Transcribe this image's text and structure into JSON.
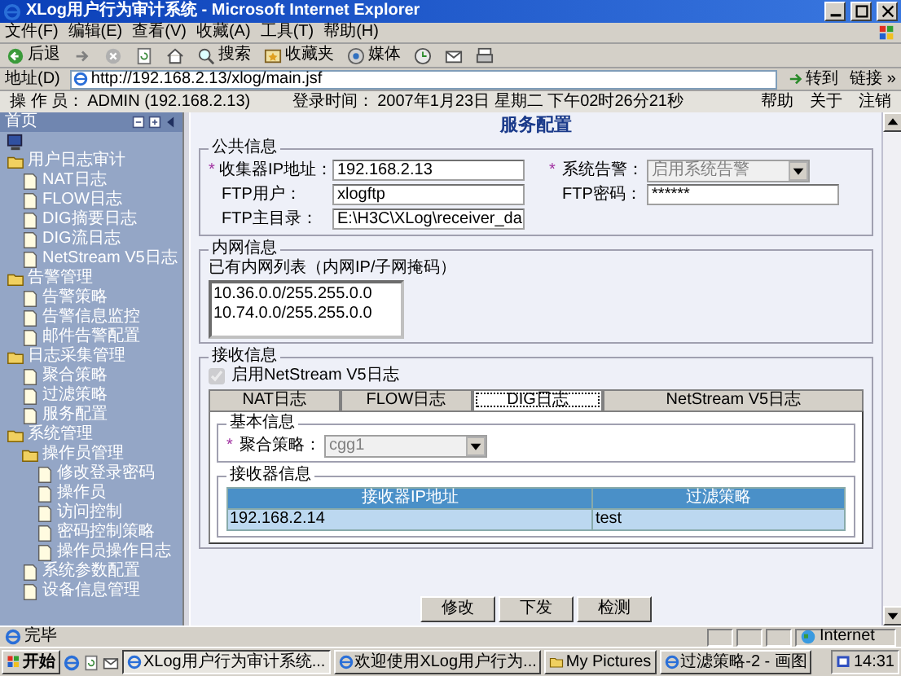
{
  "window": {
    "title": "XLog用户行为审计系统 - Microsoft Internet Explorer"
  },
  "menu": [
    "文件(F)",
    "编辑(E)",
    "查看(V)",
    "收藏(A)",
    "工具(T)",
    "帮助(H)"
  ],
  "toolbar": [
    {
      "kind": "back",
      "label": "后退"
    },
    {
      "kind": "forward"
    },
    {
      "kind": "stop"
    },
    {
      "kind": "refresh"
    },
    {
      "kind": "home"
    },
    {
      "kind": "search",
      "label": "搜索"
    },
    {
      "kind": "favorites",
      "label": "收藏夹"
    },
    {
      "kind": "media",
      "label": "媒体"
    },
    {
      "kind": "history"
    },
    {
      "kind": "mail"
    },
    {
      "kind": "print"
    }
  ],
  "address": {
    "label": "地址(D)",
    "url": "http://192.168.2.13/xlog/main.jsf",
    "go": "转到",
    "links": "链接 »"
  },
  "app_header": {
    "operator_label": "操 作 员：",
    "operator": "ADMIN (192.168.2.13)",
    "login_label": "登录时间：",
    "login_time": "2007年1月23日 星期二 下午02时26分21秒",
    "links": [
      "帮助",
      "关于",
      "注销"
    ]
  },
  "sidebar": {
    "title": "首页",
    "tree": [
      {
        "label": "用户日志审计",
        "kind": "folder",
        "children": [
          {
            "label": "NAT日志",
            "kind": "page"
          },
          {
            "label": "FLOW日志",
            "kind": "page"
          },
          {
            "label": "DIG摘要日志",
            "kind": "page"
          },
          {
            "label": "DIG流日志",
            "kind": "page"
          },
          {
            "label": "NetStream V5日志",
            "kind": "page"
          }
        ]
      },
      {
        "label": "告警管理",
        "kind": "folder",
        "children": [
          {
            "label": "告警策略",
            "kind": "page"
          },
          {
            "label": "告警信息监控",
            "kind": "page"
          },
          {
            "label": "邮件告警配置",
            "kind": "page"
          }
        ]
      },
      {
        "label": "日志采集管理",
        "kind": "folder",
        "children": [
          {
            "label": "聚合策略",
            "kind": "page"
          },
          {
            "label": "过滤策略",
            "kind": "page"
          },
          {
            "label": "服务配置",
            "kind": "page"
          }
        ]
      },
      {
        "label": "系统管理",
        "kind": "folder",
        "children": [
          {
            "label": "操作员管理",
            "kind": "folder",
            "children": [
              {
                "label": "修改登录密码",
                "kind": "page"
              },
              {
                "label": "操作员",
                "kind": "page"
              },
              {
                "label": "访问控制",
                "kind": "page"
              },
              {
                "label": "密码控制策略",
                "kind": "page"
              },
              {
                "label": "操作员操作日志",
                "kind": "page"
              }
            ]
          },
          {
            "label": "系统参数配置",
            "kind": "page"
          },
          {
            "label": "设备信息管理",
            "kind": "page"
          }
        ]
      }
    ]
  },
  "page": {
    "title": "服务配置",
    "common": {
      "legend": "公共信息",
      "rows": [
        [
          {
            "marker": "*",
            "label": "收集器IP地址：",
            "kind": "text",
            "value": "192.168.2.13",
            "disabled": false
          },
          {
            "marker": "*",
            "label": "系统告警：",
            "kind": "select",
            "value": "启用系统告警",
            "disabled": true
          }
        ],
        [
          {
            "label": "FTP用户：",
            "kind": "text",
            "value": "xlogftp",
            "disabled": false
          },
          {
            "label": "FTP密码：",
            "kind": "text",
            "value": "******",
            "disabled": false
          }
        ],
        [
          {
            "label": "FTP主目录：",
            "kind": "text",
            "value": "E:\\H3C\\XLog\\receiver_da",
            "disabled": false
          }
        ]
      ]
    },
    "intranet": {
      "legend": "内网信息",
      "list_label": "已有内网列表（内网IP/子网掩码）",
      "items": [
        "10.36.0.0/255.255.0.0",
        "10.74.0.0/255.255.0.0"
      ]
    },
    "receive": {
      "legend": "接收信息",
      "checkbox": {
        "label": "启用NetStream V5日志",
        "checked": true,
        "disabled": true
      },
      "tabs": [
        {
          "label": "NAT日志",
          "selected": false
        },
        {
          "label": "FLOW日志",
          "selected": false
        },
        {
          "label": "DIG日志",
          "selected": true
        },
        {
          "label": "NetStream V5日志",
          "selected": false
        }
      ],
      "basic": {
        "legend": "基本信息",
        "field": {
          "marker": "*",
          "label": "聚合策略：",
          "kind": "select",
          "value": "cgg1",
          "disabled": true
        }
      },
      "receivers": {
        "legend": "接收器信息",
        "columns": [
          "接收器IP地址",
          "过滤策略"
        ],
        "rows": [
          [
            "192.168.2.14",
            "test"
          ]
        ]
      }
    },
    "buttons": [
      "修改",
      "下发",
      "检测"
    ]
  },
  "status_bar": {
    "text": "完毕",
    "zone": "Internet"
  },
  "taskbar": {
    "start": "开始",
    "tasks": [
      {
        "label": "XLog用户行为审计系统...",
        "selected": true
      },
      {
        "label": "欢迎使用XLog用户行为...",
        "selected": false
      },
      {
        "label": "My Pictures",
        "selected": false
      },
      {
        "label": "过滤策略-2 - 画图",
        "selected": false
      }
    ],
    "clock": "14:31"
  }
}
